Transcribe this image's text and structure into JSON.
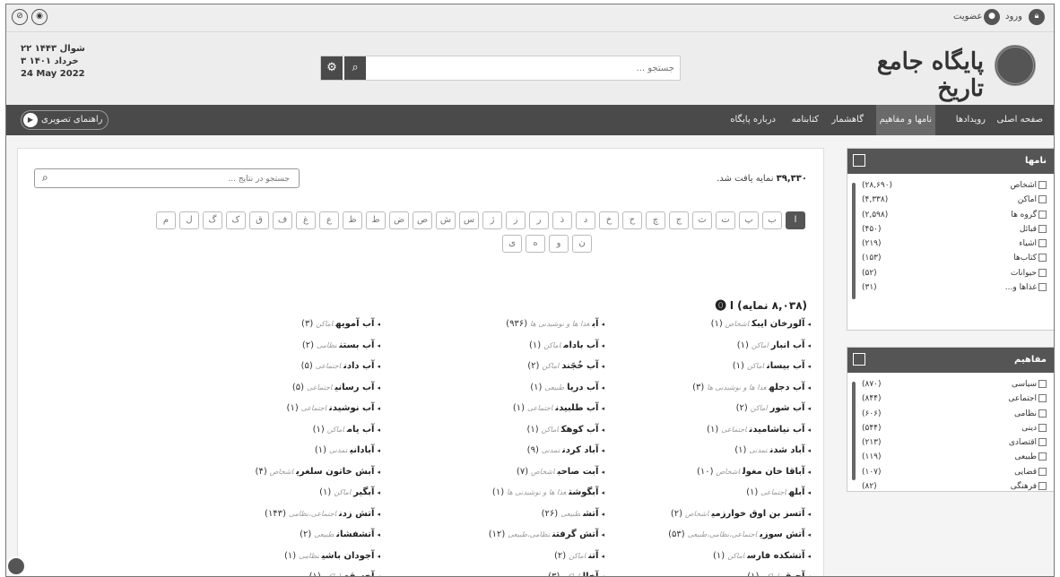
{
  "topbar": {
    "login": "ورود",
    "signup": "عضویت"
  },
  "header": {
    "date_hijri": "۲۲ شوال ۱۴۴۳",
    "date_shamsi": "۳ خرداد ۱۴۰۱",
    "date_gregorian": "24 May 2022",
    "search_placeholder": "جستجو ...",
    "logo_text": "پایگاه جامع تاریخ"
  },
  "nav": {
    "items": [
      "صفحه اصلی",
      "رویدادها",
      "نامها و مفاهیم",
      "گاهشمار",
      "کتابنامه",
      "درباره پایگاه"
    ],
    "active_index": 2,
    "guide_label": "راهنمای تصویری"
  },
  "main": {
    "search_placeholder": "جستجو در نتایج ...",
    "found_count": "۳۹,۳۳۰",
    "found_label": "نمایه یافت شد.",
    "letters_row1": [
      "ا",
      "ب",
      "پ",
      "ت",
      "ث",
      "ج",
      "چ",
      "ح",
      "خ",
      "د",
      "ذ",
      "ر",
      "ز",
      "ژ",
      "س",
      "ش",
      "ص",
      "ض",
      "ط",
      "ظ",
      "ع",
      "غ",
      "ف",
      "ق",
      "ک",
      "گ",
      "ل",
      "م"
    ],
    "letters_row2": [
      "ن",
      "و",
      "ه",
      "ی"
    ],
    "section_title": "(۸,۰۳۸ نمایه) ا",
    "columns": [
      [
        {
          "name": "آلورخان ایبک",
          "cat": "اشخاص",
          "count": "(۱)"
        },
        {
          "name": "آب انبار",
          "cat": "اماکن",
          "count": "(۱)"
        },
        {
          "name": "آب بیسان",
          "cat": "اماکن",
          "count": "(۱)"
        },
        {
          "name": "آب دجله",
          "cat": "غذا ها و نوشیدنی ها",
          "count": "(۳)"
        },
        {
          "name": "آب شور",
          "cat": "اماکن",
          "count": "(۲)"
        },
        {
          "name": "آب نیاشامیدن",
          "cat": "اجتماعی",
          "count": "(۱)"
        },
        {
          "name": "آباد شدن",
          "cat": "تمدنی",
          "count": "(۱)"
        },
        {
          "name": "آباقا خان مغول",
          "cat": "اشخاص",
          "count": "(۱۰)"
        },
        {
          "name": "آبله",
          "cat": "اجتماعی",
          "count": "(۱)"
        },
        {
          "name": "آتسز بن اوق خوارزمی",
          "cat": "اشخاص",
          "count": "(۲)"
        },
        {
          "name": "آتش سوزی",
          "cat": "اجتماعی،نظامی،طبیعی",
          "count": "(۵۳)"
        },
        {
          "name": "آتشکده فارس",
          "cat": "اماکن",
          "count": "(۱)"
        },
        {
          "name": "آجیقی",
          "cat": "اماکن",
          "count": "(۱)"
        }
      ],
      [
        {
          "name": "آب",
          "cat": "غذا ها و نوشیدنی ها",
          "count": "(۹۳۶)"
        },
        {
          "name": "آب بادام",
          "cat": "اماکن",
          "count": "(۱)"
        },
        {
          "name": "آب خُجَند",
          "cat": "اماکن",
          "count": "(۲)"
        },
        {
          "name": "آب دریا",
          "cat": "طبیعی",
          "count": "(۱)"
        },
        {
          "name": "آب طلبیدن",
          "cat": "اجتماعی",
          "count": "(۱)"
        },
        {
          "name": "آب کوهک",
          "cat": "اماکن",
          "count": "(۱)"
        },
        {
          "name": "آباد کردن",
          "cat": "تمدنی",
          "count": "(۹)"
        },
        {
          "name": "آبت صاحب",
          "cat": "اشخاص",
          "count": "(۷)"
        },
        {
          "name": "آبگوشت",
          "cat": "غذا ها و نوشیدنی ها",
          "count": "(۱)"
        },
        {
          "name": "آتش",
          "cat": "طبیعی",
          "count": "(۲۶)"
        },
        {
          "name": "آتش گرفتن",
          "cat": "نظامی،طبیعی",
          "count": "(۱۲)"
        },
        {
          "name": "آتن",
          "cat": "اماکن",
          "count": "(۲)"
        },
        {
          "name": "آخال",
          "cat": "اماکن",
          "count": "(۳)"
        }
      ],
      [
        {
          "name": "آب آمویه",
          "cat": "اماکن",
          "count": "(۳)"
        },
        {
          "name": "آب بستن",
          "cat": "نظامی",
          "count": "(۲)"
        },
        {
          "name": "آب دادن",
          "cat": "اجتماعی",
          "count": "(۵)"
        },
        {
          "name": "آب رسانی",
          "cat": "اجتماعی",
          "count": "(۵)"
        },
        {
          "name": "آب نوشیدن",
          "cat": "اجتماعی",
          "count": "(۱)"
        },
        {
          "name": "آب یام",
          "cat": "اماکن",
          "count": "(۱)"
        },
        {
          "name": "آبادانی",
          "cat": "تمدنی",
          "count": "(۱)"
        },
        {
          "name": "آبش خاتون سلغری",
          "cat": "اشخاص",
          "count": "(۴)"
        },
        {
          "name": "آبگیر",
          "cat": "اماکن",
          "count": "(۱)"
        },
        {
          "name": "آتش زدن",
          "cat": "اجتماعی،نظامی",
          "count": "(۱۴۳)"
        },
        {
          "name": "آتشفشان",
          "cat": "طبیعی",
          "count": "(۲)"
        },
        {
          "name": "آجودان باشی",
          "cat": "نظامی",
          "count": "(۱)"
        },
        {
          "name": "آخسقه",
          "cat": "اماکن",
          "count": "(۱)"
        }
      ]
    ]
  },
  "sidebar": {
    "names_title": "نامها",
    "names": [
      {
        "label": "اشخاص",
        "count": "(۲۸,۶۹۰)"
      },
      {
        "label": "اماکن",
        "count": "(۴,۳۳۸)"
      },
      {
        "label": "گروه ها",
        "count": "(۲,۵۹۸)"
      },
      {
        "label": "قبائل",
        "count": "(۴۵۰)"
      },
      {
        "label": "اشیاء",
        "count": "(۲۱۹)"
      },
      {
        "label": "کتاب‌ها",
        "count": "(۱۵۳)"
      },
      {
        "label": "حیوانات",
        "count": "(۵۲)"
      },
      {
        "label": "غذاها و...",
        "count": "(۳۱)"
      }
    ],
    "concepts_title": "مفاهیم",
    "concepts": [
      {
        "label": "سیاسی",
        "count": "(۸۷۰)"
      },
      {
        "label": "اجتماعی",
        "count": "(۸۴۴)"
      },
      {
        "label": "نظامی",
        "count": "(۶۰۶)"
      },
      {
        "label": "دینی",
        "count": "(۵۴۴)"
      },
      {
        "label": "اقتصادی",
        "count": "(۲۱۳)"
      },
      {
        "label": "طبیعی",
        "count": "(۱۱۹)"
      },
      {
        "label": "قضایی",
        "count": "(۱۰۷)"
      },
      {
        "label": "فرهنگی",
        "count": "(۸۲)"
      }
    ]
  }
}
